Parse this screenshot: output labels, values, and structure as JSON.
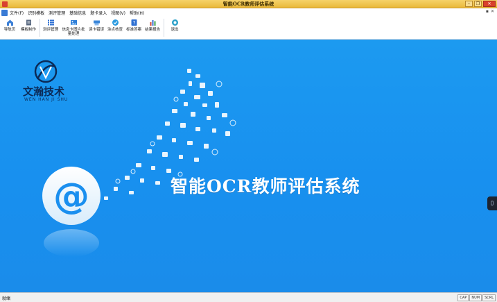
{
  "window": {
    "title": "智能OCR教师评估系统"
  },
  "menu": {
    "items": [
      "文件(F)",
      "识别模板",
      "测评管理",
      "基础信息",
      "题卡录入",
      "视图(V)",
      "帮助(H)"
    ]
  },
  "toolbar": {
    "buttons": [
      {
        "label": "导航页",
        "icon": "navigation-icon",
        "color": "#3c7fd6"
      },
      {
        "label": "模板制作",
        "icon": "template-icon",
        "color": "#5b6b82"
      },
      {
        "label": "测评管理",
        "icon": "list-icon",
        "color": "#2d6fd2"
      },
      {
        "label": "信息卡图片批量处理",
        "icon": "batch-image-icon",
        "color": "#2f7fd8"
      },
      {
        "label": "读卡错误",
        "icon": "card-error-icon",
        "color": "#3a86d9"
      },
      {
        "label": "涂点核查",
        "icon": "check-dot-icon",
        "color": "#2b9be0"
      },
      {
        "label": "标准答案",
        "icon": "answer-icon",
        "color": "#2d6fd2"
      },
      {
        "label": "结果报告",
        "icon": "report-icon",
        "color": "#d24a36"
      },
      {
        "label": "退出",
        "icon": "exit-icon",
        "color": "#2aa0c8"
      }
    ]
  },
  "canvas": {
    "brand_cn": "文瀚技术",
    "brand_en": "WEN HAN JI SHU",
    "main_title": "智能OCR教师评估系统",
    "background": "#1a8fef"
  },
  "status": {
    "text": "就绪",
    "indicators": [
      "CAP",
      "NUM",
      "SCRL"
    ]
  }
}
